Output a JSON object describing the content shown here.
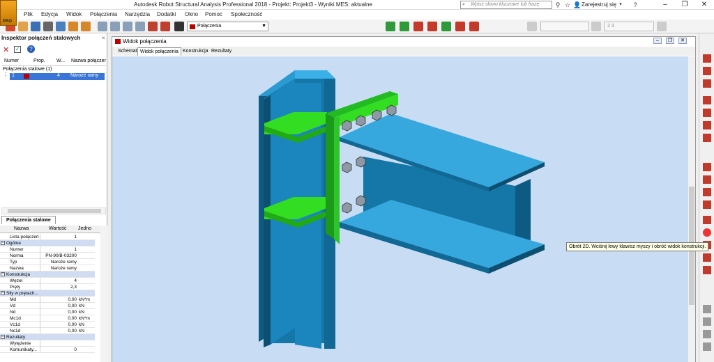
{
  "titlebar": {
    "title": "Autodesk Robot Structural Analysis Professional 2018 - Projekt: Projekt3 - Wyniki MES: aktualne",
    "search_placeholder": "Wpisz słowo kluczowe lub frazę",
    "signin_label": "Zarejestruj się",
    "app_logo_label": "PRO"
  },
  "menu": [
    "Plik",
    "Edycja",
    "Widok",
    "Połączenia",
    "Narzędzia",
    "Dodatki",
    "Okno",
    "Pomoc",
    "Społeczność"
  ],
  "toolbar": {
    "layout_combo_value": "Połączenia",
    "case_combo_value": "",
    "combo3_value": "2 3"
  },
  "inspector": {
    "title": "Inspektor połączeń stalowych",
    "columns": [
      "Numer",
      "Prop.",
      "W...",
      "Nazwa połączer"
    ],
    "tree_root": "Połączenia stalowe (1)",
    "selected_row": {
      "number": "1",
      "prop": "",
      "w": "4",
      "name": "Naroże ramy"
    },
    "bottom_tab": "Połączenia stalowe"
  },
  "properties": {
    "headers": {
      "name": "Nazwa",
      "value": "Wartość",
      "unit": "Jedno"
    },
    "rows": [
      {
        "type": "plain",
        "key": "Lista połączeń",
        "value": "1",
        "unit": ""
      },
      {
        "type": "section",
        "key": "Ogólne"
      },
      {
        "type": "item",
        "key": "Numer",
        "value": "1",
        "unit": ""
      },
      {
        "type": "item",
        "key": "Norma",
        "value": "PN-90/B-03200",
        "unit": ""
      },
      {
        "type": "item",
        "key": "Typ",
        "value": "Naroże ramy",
        "unit": ""
      },
      {
        "type": "item",
        "key": "Nazwa",
        "value": "Naroże ramy",
        "unit": ""
      },
      {
        "type": "section",
        "key": "Konstrukcja"
      },
      {
        "type": "item",
        "key": "Węzeł",
        "value": "4",
        "unit": ""
      },
      {
        "type": "item",
        "key": "Pręty",
        "value": "2,3",
        "unit": ""
      },
      {
        "type": "section",
        "key": "Siły w prętach..."
      },
      {
        "type": "item",
        "key": "Md",
        "value": "0,00",
        "unit": "kN*m"
      },
      {
        "type": "item",
        "key": "Vd",
        "value": "0,00",
        "unit": "kN"
      },
      {
        "type": "item",
        "key": "Nd",
        "value": "0,00",
        "unit": "kN"
      },
      {
        "type": "item",
        "key": "Mc1d",
        "value": "0,00",
        "unit": "kN*m"
      },
      {
        "type": "item",
        "key": "Vc1d",
        "value": "0,00",
        "unit": "kN"
      },
      {
        "type": "item",
        "key": "Nc1d",
        "value": "0,00",
        "unit": "kN"
      },
      {
        "type": "section",
        "key": "Rezultaty"
      },
      {
        "type": "item",
        "key": "Wytężenie",
        "value": "",
        "unit": ""
      },
      {
        "type": "item",
        "key": "Komunikaty...",
        "value": "0",
        "unit": ""
      }
    ]
  },
  "view_window": {
    "title": "Widok połączenia",
    "tabs": [
      "Schemat",
      "Widok połączenia",
      "Konstrukcja",
      "Rezultaty"
    ],
    "active_tab": "Widok połączenia"
  },
  "tooltip": "Obrót 2D. Wciśnij lewy klawisz myszy i obróć widok konstrukcji.",
  "colors": {
    "steel": "#1b8fc6",
    "steel_top": "#3ab0e6",
    "steel_dark": "#0d4f70",
    "stiffener": "#33dd22",
    "bolt": "#8d9aa6",
    "canvas_bg": "#c8dcf3"
  }
}
